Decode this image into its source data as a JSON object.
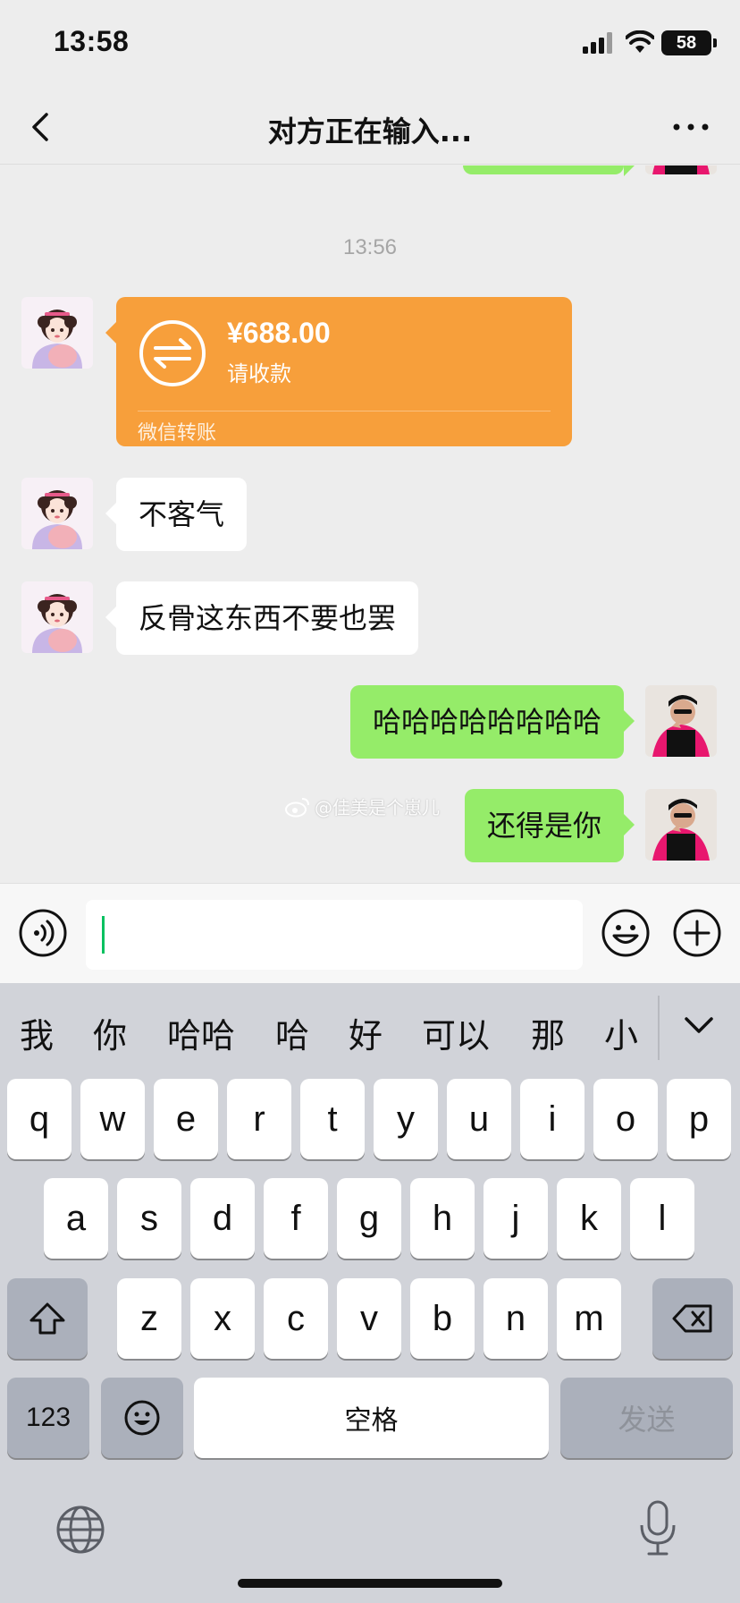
{
  "status_bar": {
    "time": "13:58",
    "battery": "58"
  },
  "nav": {
    "title": "对方正在输入..."
  },
  "chat": {
    "timestamp": "13:56",
    "transfer": {
      "amount": "¥688.00",
      "status": "请收款",
      "footer": "微信转账"
    },
    "messages": [
      {
        "side": "left",
        "text": "不客气"
      },
      {
        "side": "left",
        "text": "反骨这东西不要也罢"
      },
      {
        "side": "right",
        "text": "哈哈哈哈哈哈哈哈"
      },
      {
        "side": "right",
        "text": "还得是你"
      }
    ],
    "watermark": "@佳美是个崽儿"
  },
  "input": {
    "value": ""
  },
  "keyboard": {
    "candidates": [
      "我",
      "你",
      "哈哈",
      "哈",
      "好",
      "可以",
      "那",
      "小"
    ],
    "row1": [
      "q",
      "w",
      "e",
      "r",
      "t",
      "y",
      "u",
      "i",
      "o",
      "p"
    ],
    "row2": [
      "a",
      "s",
      "d",
      "f",
      "g",
      "h",
      "j",
      "k",
      "l"
    ],
    "row3": [
      "z",
      "x",
      "c",
      "v",
      "b",
      "n",
      "m"
    ],
    "numbers_label": "123",
    "space_label": "空格",
    "send_label": "发送"
  },
  "colors": {
    "bubble_sent": "#95ec69",
    "bubble_received": "#ffffff",
    "transfer": "#f79f3b",
    "caret": "#07c160"
  }
}
